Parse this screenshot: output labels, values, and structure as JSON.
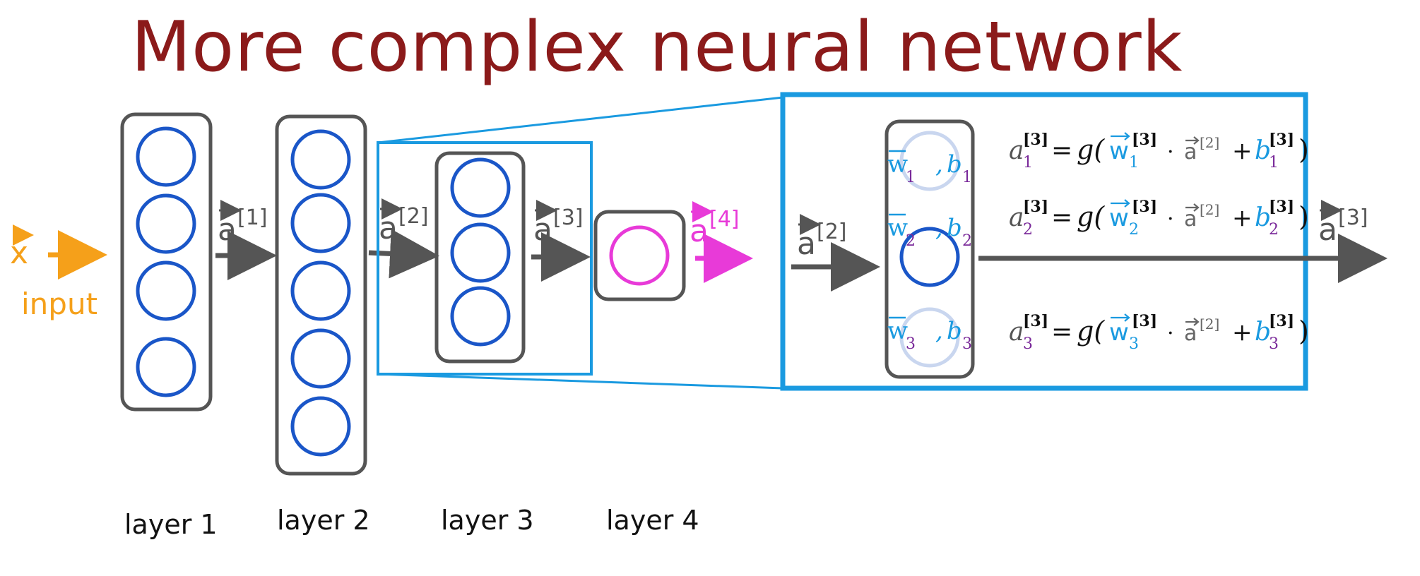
{
  "title": "More complex neural network",
  "input": {
    "vector": "x",
    "label": "input"
  },
  "activations": {
    "a1": {
      "base": "a",
      "sup": "[1]"
    },
    "a2": {
      "base": "a",
      "sup": "[2]"
    },
    "a3": {
      "base": "a",
      "sup": "[3]"
    },
    "a4": {
      "base": "a",
      "sup": "[4]"
    }
  },
  "layers": [
    {
      "label": "layer 1",
      "neurons": 4
    },
    {
      "label": "layer 2",
      "neurons": 5
    },
    {
      "label": "layer 3",
      "neurons": 3
    },
    {
      "label": "layer 4",
      "neurons": 1
    }
  ],
  "zoom": {
    "input_activation": {
      "base": "a",
      "sup": "[2]"
    },
    "output_activation": {
      "base": "a",
      "sup": "[3]"
    },
    "units": [
      {
        "w": "w",
        "w_sub": "1",
        "b": "b",
        "b_sub": "1"
      },
      {
        "w": "w",
        "w_sub": "2",
        "b": "b",
        "b_sub": "2"
      },
      {
        "w": "w",
        "w_sub": "3",
        "b": "b",
        "b_sub": "3"
      }
    ],
    "equations": [
      {
        "lhs": "a",
        "lhs_sub": "1",
        "lhs_sup": "[3]",
        "eq": "=",
        "g": "g(",
        "w": "w",
        "w_sub": "1",
        "w_sup": "[3]",
        "dot": "·",
        "a": "a",
        "a_sup": "[2]",
        "plus": "+",
        "b": "b",
        "b_sub": "1",
        "b_sup": "[3]",
        "close": ")"
      },
      {
        "lhs": "a",
        "lhs_sub": "2",
        "lhs_sup": "[3]",
        "eq": "=",
        "g": "g(",
        "w": "w",
        "w_sub": "2",
        "w_sup": "[3]",
        "dot": "·",
        "a": "a",
        "a_sup": "[2]",
        "plus": "+",
        "b": "b",
        "b_sub": "2",
        "b_sup": "[3]",
        "close": ")"
      },
      {
        "lhs": "a",
        "lhs_sub": "3",
        "lhs_sup": "[3]",
        "eq": "=",
        "g": "g(",
        "w": "w",
        "w_sub": "3",
        "w_sup": "[3]",
        "dot": "·",
        "a": "a",
        "a_sup": "[2]",
        "plus": "+",
        "b": "b",
        "b_sub": "3",
        "b_sup": "[3]",
        "close": ")"
      }
    ]
  },
  "colors": {
    "title": "#8b1a1a",
    "neuron": "#1a56c8",
    "box": "#555555",
    "highlight": "#1a9ae0",
    "input": "#f5a01a",
    "output_neuron": "#e83ad8",
    "w": "#1a9ae0",
    "b_sub": "#7a2a9a",
    "lhs": "#7a2a9a",
    "arrow": "#555555"
  }
}
